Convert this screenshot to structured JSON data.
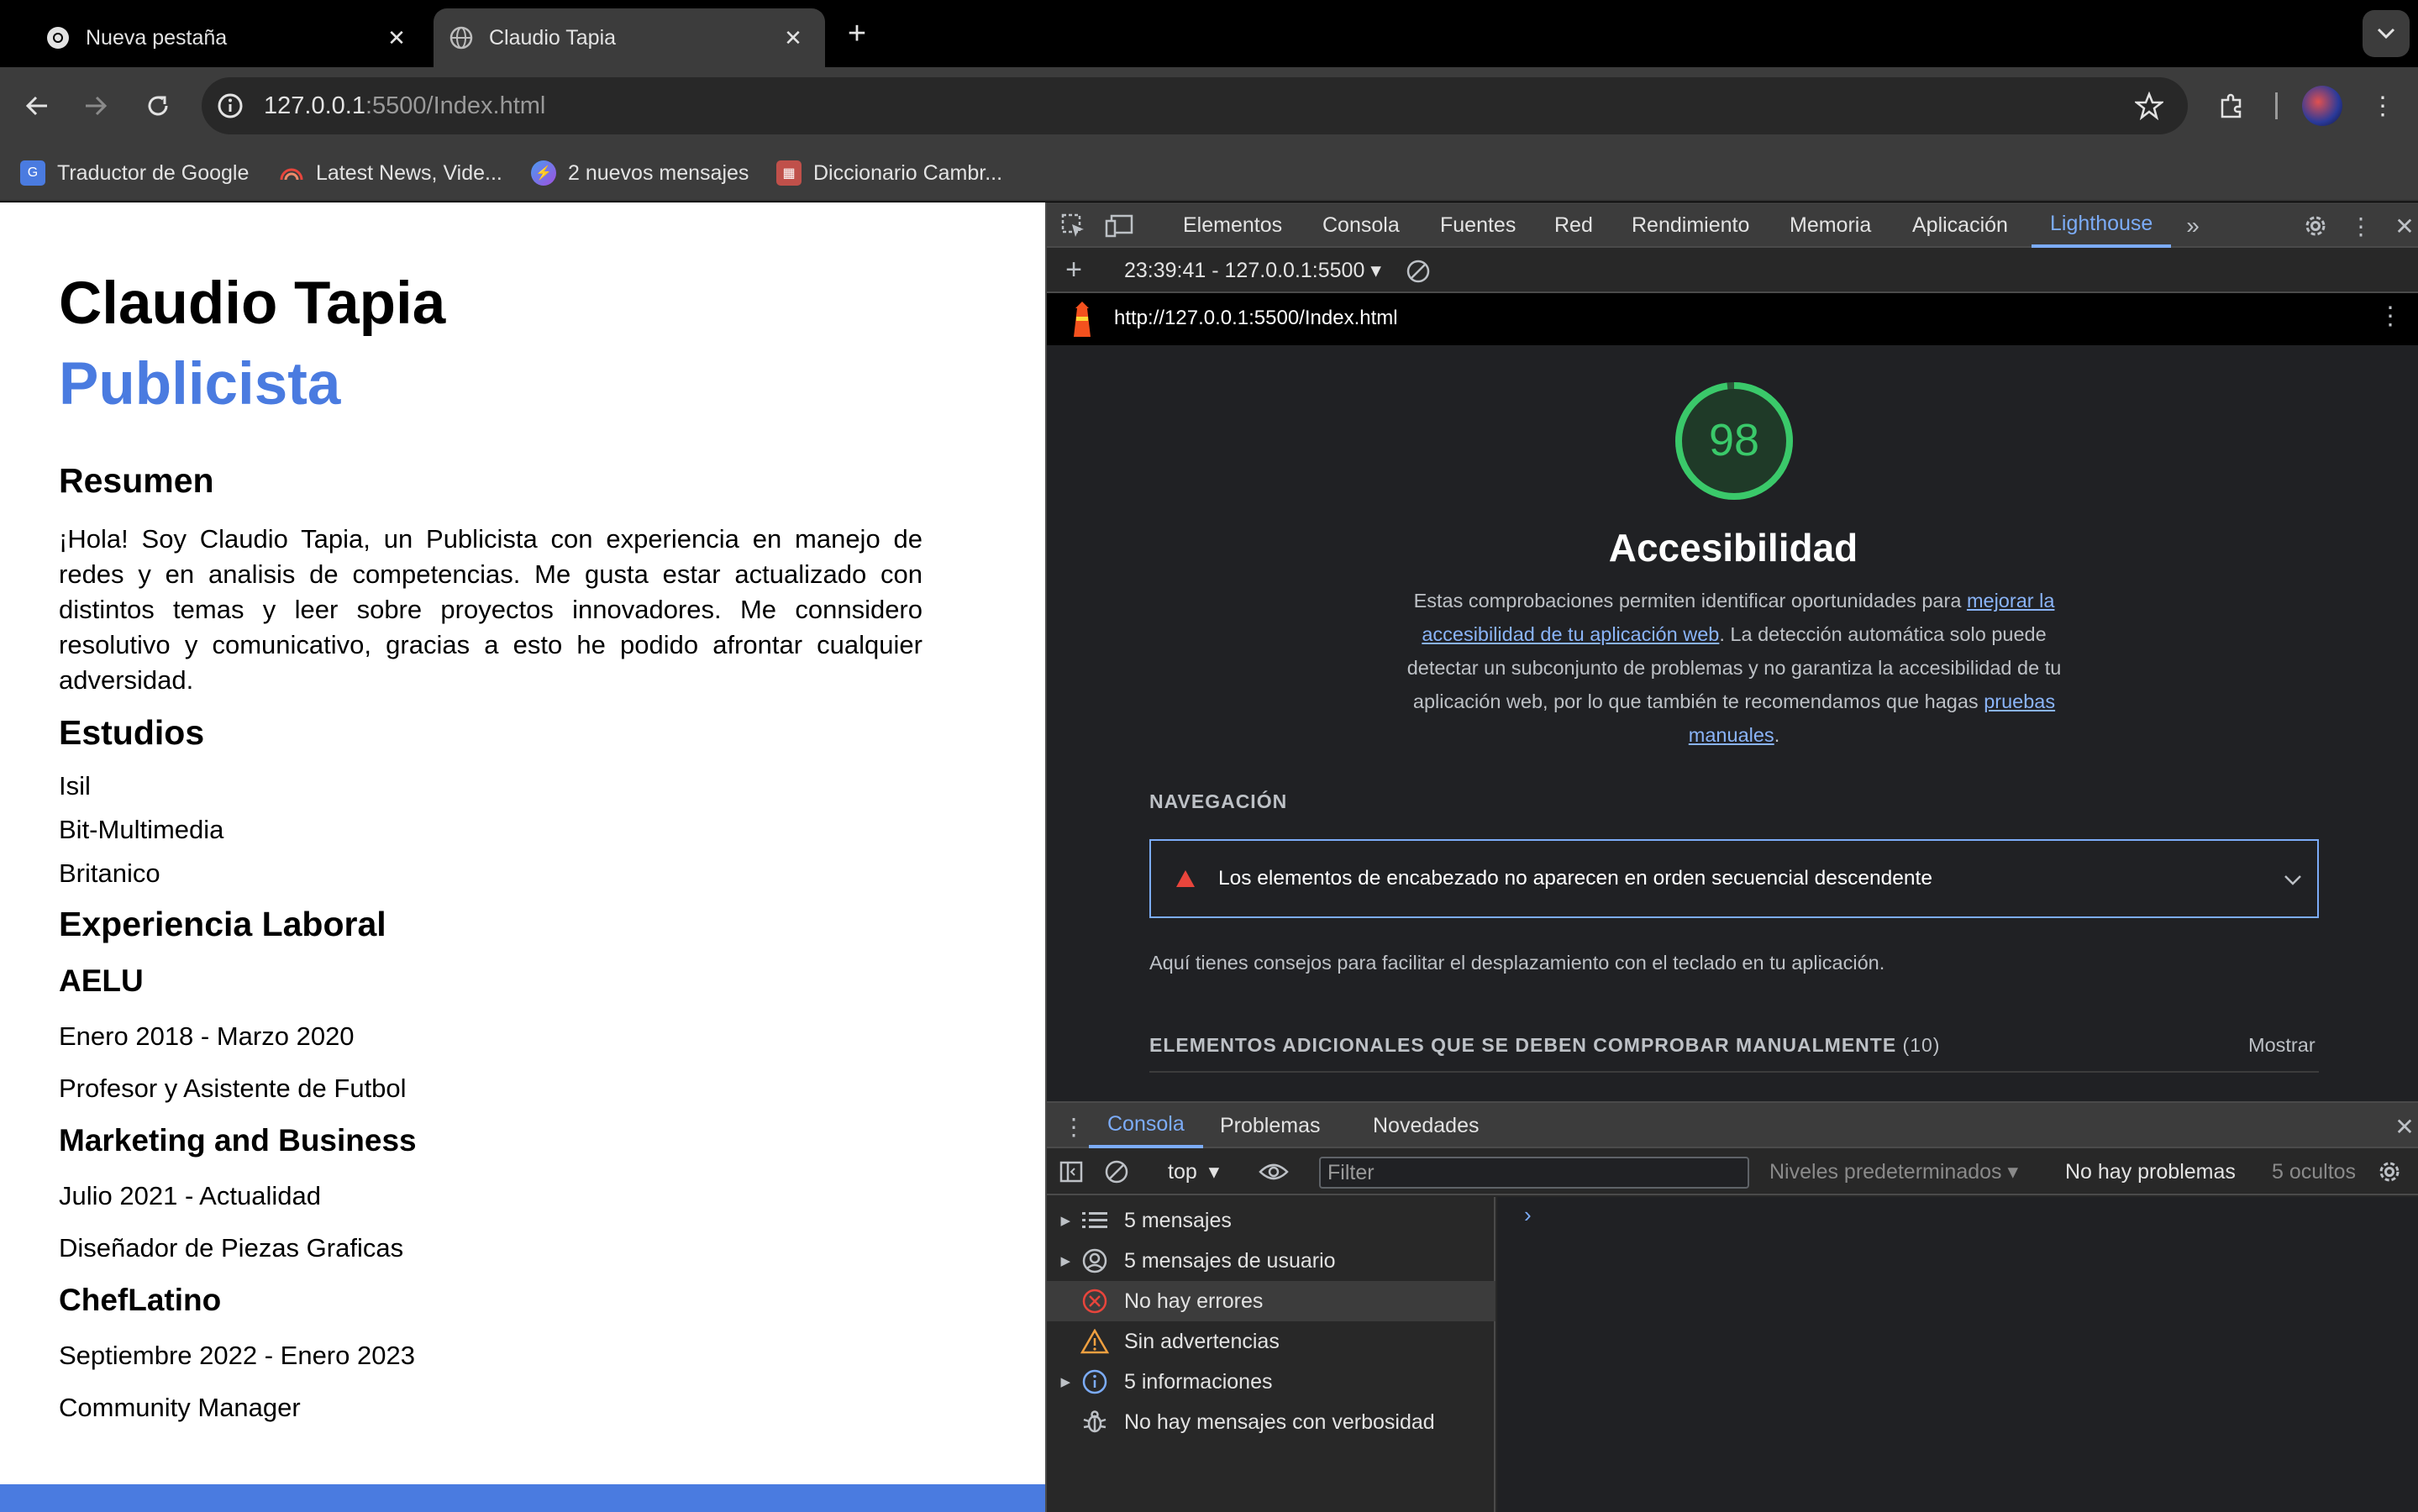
{
  "browser": {
    "tabs": [
      {
        "title": "Nueva pestaña",
        "active": false
      },
      {
        "title": "Claudio Tapia",
        "active": true
      }
    ],
    "omnibox": {
      "host": "127.0.0.1",
      "path": ":5500/Index.html"
    },
    "bookmarks": [
      {
        "label": "Traductor de Google",
        "icon": "google-translate-icon"
      },
      {
        "label": "Latest News, Vide...",
        "icon": "rainbow-news-icon"
      },
      {
        "label": "2 nuevos mensajes",
        "icon": "messenger-icon"
      },
      {
        "label": "Diccionario Cambr...",
        "icon": "cambridge-crest-icon"
      }
    ]
  },
  "page": {
    "name": "Claudio Tapia",
    "role": "Publicista",
    "summary_heading": "Resumen",
    "summary": "¡Hola! Soy Claudio Tapia, un Publicista con experiencia en manejo de redes y en analisis de competencias. Me gusta estar actualizado con distintos temas y leer sobre proyectos innovadores. Me connsidero resolutivo y comunicativo, gracias a esto he podido afrontar cualquier adversidad.",
    "studies_heading": "Estudios",
    "studies": [
      "Isil",
      "Bit-Multimedia",
      "Britanico"
    ],
    "experience_heading": "Experiencia Laboral",
    "jobs": [
      {
        "company": "AELU",
        "period": "Enero 2018 - Marzo 2020",
        "position": "Profesor y Asistente de Futbol"
      },
      {
        "company": "Marketing and Business",
        "period": "Julio 2021 - Actualidad",
        "position": "Diseñador de Piezas Graficas"
      },
      {
        "company": "ChefLatino",
        "period": "Septiembre 2022 - Enero 2023",
        "position": "Community Manager"
      }
    ],
    "accent_color": "#4a7be0"
  },
  "devtools": {
    "tabs": [
      "Elementos",
      "Consola",
      "Fuentes",
      "Red",
      "Rendimiento",
      "Memoria",
      "Aplicación",
      "Lighthouse"
    ],
    "active_tab": "Lighthouse",
    "lighthouse": {
      "run_selector": "23:39:41 - 127.0.0.1:5500",
      "report_url": "http://127.0.0.1:5500/Index.html",
      "score": "98",
      "score_color": "#3ac96a",
      "category": "Accesibilidad",
      "description_pre": "Estas comprobaciones permiten identificar oportunidades para ",
      "description_link1": "mejorar la accesibilidad de tu aplicación web",
      "description_mid": ". La detección automática solo puede detectar un subconjunto de problemas y no garantiza la accesibilidad de tu aplicación web, por lo que también te recomendamos que hagas ",
      "description_link2": "pruebas manuales",
      "description_post": ".",
      "group_title": "NAVEGACIÓN",
      "audit": "Los elementos de encabezado no aparecen en orden secuencial descendente",
      "group_description": "Aquí tienes consejos para facilitar el desplazamiento con el teclado en tu aplicación.",
      "manual_title": "ELEMENTOS ADICIONALES QUE SE DEBEN COMPROBAR MANUALMENTE",
      "manual_count": "(10)",
      "manual_show": "Mostrar"
    },
    "drawer": {
      "tabs": [
        "Consola",
        "Problemas",
        "Novedades"
      ],
      "active_tab": "Consola",
      "context": "top",
      "filter_placeholder": "Filter",
      "levels": "Niveles predeterminados",
      "issues": "No hay problemas",
      "hidden": "5 ocultos",
      "sidebar": [
        {
          "label": "5 mensajes",
          "icon": "list-icon",
          "expandable": true
        },
        {
          "label": "5 mensajes de usuario",
          "icon": "user-circle-icon",
          "expandable": true
        },
        {
          "label": "No hay errores",
          "icon": "error-icon",
          "expandable": false
        },
        {
          "label": "Sin advertencias",
          "icon": "warning-icon",
          "expandable": false
        },
        {
          "label": "5 informaciones",
          "icon": "info-icon",
          "expandable": true
        },
        {
          "label": "No hay mensajes con verbosidad",
          "icon": "bug-icon",
          "expandable": false
        }
      ],
      "prompt": "›"
    }
  }
}
